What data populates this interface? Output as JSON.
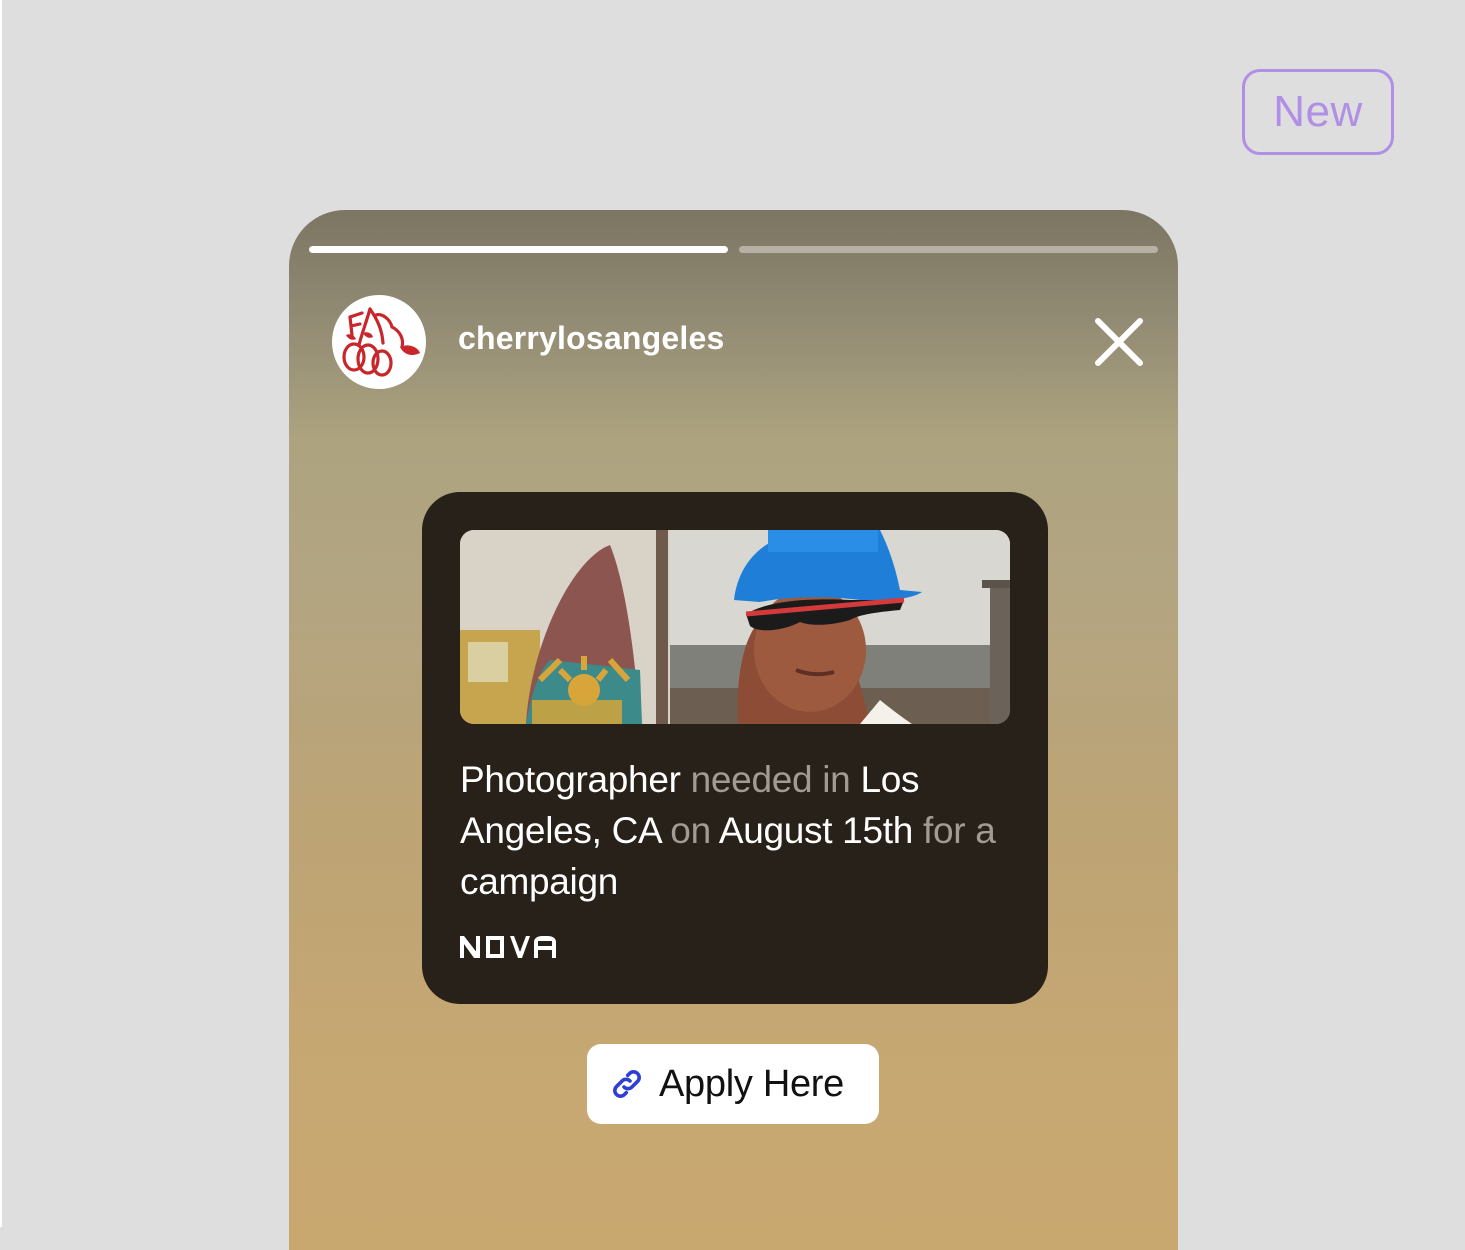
{
  "badge": {
    "label": "New",
    "color": "#b08fe6"
  },
  "story": {
    "progress": [
      {
        "label": "segment-1",
        "fill": 1.0
      },
      {
        "label": "segment-2",
        "fill": 0.0
      }
    ],
    "account": {
      "username": "cherrylosangeles",
      "avatar_icon": "cherry-logo-icon"
    },
    "close_icon": "close-icon",
    "job_card": {
      "photo_alt": "surfboard-and-model-photo",
      "headline": [
        {
          "text": "Photographer",
          "muted": false
        },
        {
          "text": " needed in ",
          "muted": true
        },
        {
          "text": "Los Angeles, CA",
          "muted": false
        },
        {
          "text": " on ",
          "muted": true
        },
        {
          "text": "August 15th",
          "muted": false
        },
        {
          "text": " for a ",
          "muted": true
        },
        {
          "text": "campaign",
          "muted": false
        }
      ],
      "brand_logo": "NOVA"
    },
    "apply_button": {
      "label": "Apply Here",
      "icon": "link-icon",
      "icon_color": "#2f3fd6"
    }
  }
}
